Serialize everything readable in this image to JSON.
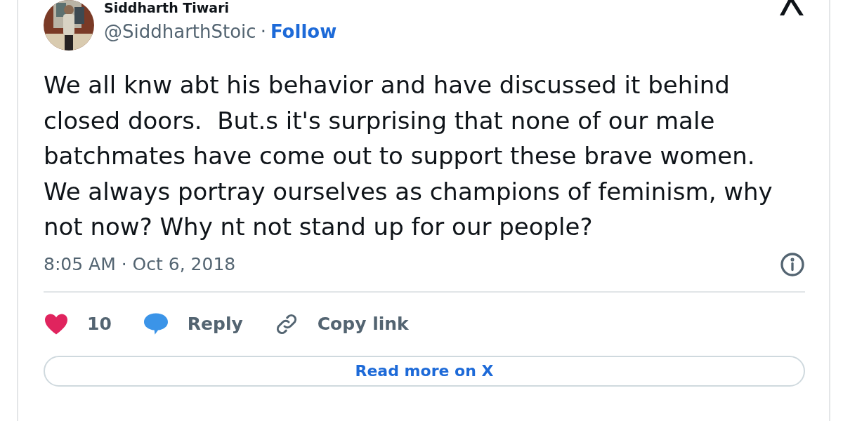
{
  "author": {
    "name": "Siddharth Tiwari",
    "handle": "@SiddharthStoic",
    "separator": "·",
    "follow": "Follow"
  },
  "tweet": {
    "text": "We all knw abt his behavior and have discussed it behind closed doors.  But.s it's surprising that none of our male batchmates have come out to support these brave women. We always portray ourselves as champions of feminism, why not now? Why nt not stand up for our people?",
    "time": "8:05 AM · Oct 6, 2018"
  },
  "actions": [
    {
      "kind": "like",
      "label": "10"
    },
    {
      "kind": "reply",
      "label": "Reply"
    },
    {
      "kind": "copy",
      "label": "Copy link"
    }
  ],
  "read_more": "Read more on X"
}
